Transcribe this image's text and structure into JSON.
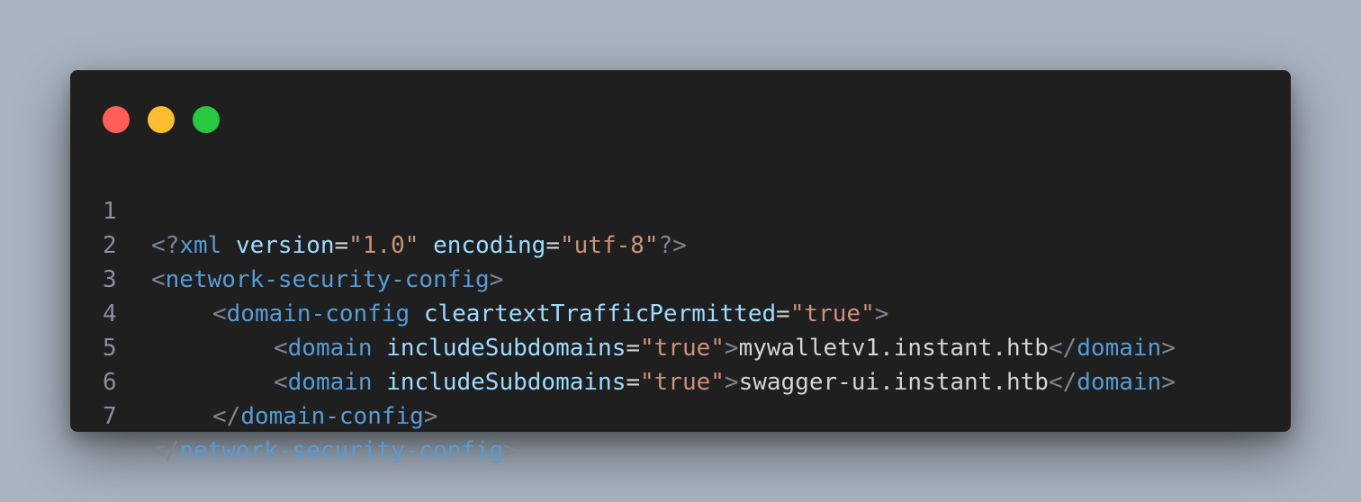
{
  "window": {
    "controls": {
      "close_color": "#ff5f57",
      "minimize_color": "#febc2e",
      "maximize_color": "#28c840"
    }
  },
  "code": {
    "lines": [
      {
        "number": "1",
        "tokens": [
          "<?",
          "xml",
          " ",
          "version",
          "=",
          "\"1.0\"",
          " ",
          "encoding",
          "=",
          "\"utf-8\"",
          "?>"
        ]
      },
      {
        "number": "2",
        "tokens": [
          "<",
          "network-security-config",
          ">"
        ]
      },
      {
        "number": "3",
        "tokens": [
          "<",
          "domain-config",
          " ",
          "cleartextTrafficPermitted",
          "=",
          "\"true\"",
          ">"
        ]
      },
      {
        "number": "4",
        "tokens": [
          "<",
          "domain",
          " ",
          "includeSubdomains",
          "=",
          "\"true\"",
          ">",
          "mywalletv1.instant.htb",
          "</",
          "domain",
          ">"
        ]
      },
      {
        "number": "5",
        "tokens": [
          "<",
          "domain",
          " ",
          "includeSubdomains",
          "=",
          "\"true\"",
          ">",
          "swagger-ui.instant.htb",
          "</",
          "domain",
          ">"
        ]
      },
      {
        "number": "6",
        "tokens": [
          "</",
          "domain-config",
          ">"
        ]
      },
      {
        "number": "7",
        "tokens": [
          "</",
          "network-security-config",
          ">"
        ]
      }
    ]
  }
}
